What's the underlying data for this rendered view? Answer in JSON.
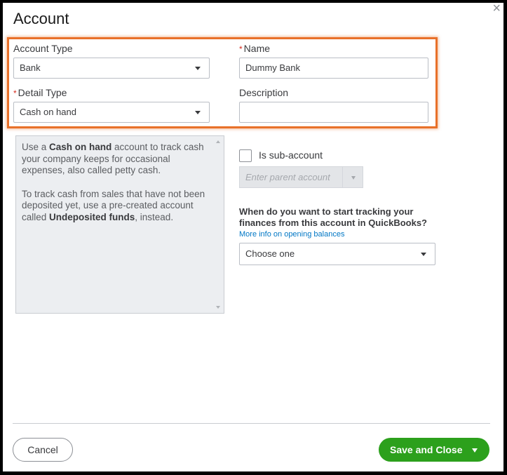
{
  "dialog": {
    "title": "Account",
    "close_icon": "×"
  },
  "form": {
    "account_type": {
      "label": "Account Type",
      "value": "Bank"
    },
    "name": {
      "required_marker": "*",
      "label": "Name",
      "value": "Dummy Bank"
    },
    "detail_type": {
      "required_marker": "*",
      "label": "Detail Type",
      "value": "Cash on hand"
    },
    "description": {
      "label": "Description",
      "value": ""
    }
  },
  "help_text": {
    "p1_pre": "Use a ",
    "p1_bold": "Cash on hand",
    "p1_post": " account to track cash your company keeps for occasional expenses, also called petty cash.",
    "p2_pre": "To track cash from sales that have not been deposited yet, use a pre-created account called ",
    "p2_bold": "Undeposited funds",
    "p2_post": ", instead."
  },
  "sub_account": {
    "checkbox_label": "Is sub-account",
    "checked": false,
    "parent_placeholder": "Enter parent account"
  },
  "opening_balance": {
    "question": "When do you want to start tracking your finances from this account in QuickBooks?",
    "link": "More info on opening balances",
    "select_value": "Choose one"
  },
  "footer": {
    "cancel_label": "Cancel",
    "save_label": "Save and Close"
  },
  "colors": {
    "highlight": "#e8712a",
    "primary_button": "#2ca01c",
    "link": "#0077c5",
    "required": "#d52b1e"
  }
}
